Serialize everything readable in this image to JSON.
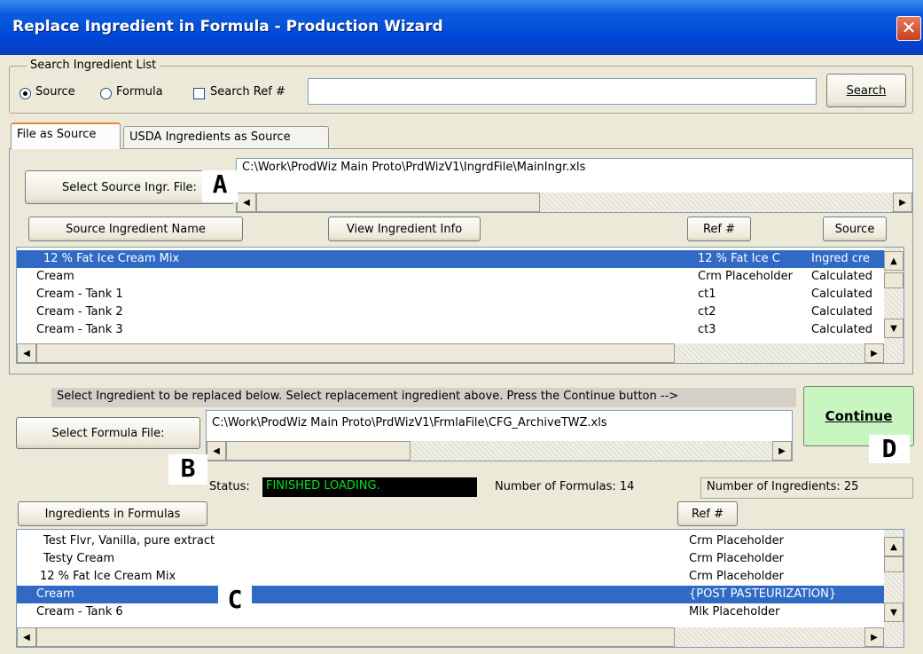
{
  "window": {
    "title": "Replace Ingredient in Formula - Production Wizard",
    "close_glyph": "✕"
  },
  "search": {
    "group_label": "Search Ingredient List",
    "radio_source_label": "Source",
    "radio_formula_label": "Formula",
    "radio_selected": "Source",
    "checkbox_label": "Search Ref #",
    "checkbox_checked": false,
    "input_value": "",
    "button_label": "Search"
  },
  "tabs": [
    {
      "label": "File as Source",
      "active": true
    },
    {
      "label": "USDA Ingredients as Source",
      "active": false
    }
  ],
  "source": {
    "select_button_label": "Select Source Ingr. File:",
    "file_path": "C:\\Work\\ProdWiz Main Proto\\PrdWizV1\\IngrdFile\\MainIngr.xls",
    "header_buttons": {
      "name": "Source Ingredient Name",
      "info": "View Ingredient Info",
      "ref": "Ref #",
      "source": "Source"
    },
    "rows": [
      {
        "name": "12 % Fat Ice Cream Mix",
        "ref": "12 % Fat Ice C",
        "source": "Ingred cre",
        "selected": true
      },
      {
        "name": "Cream",
        "ref": "Crm Placeholder",
        "source": "Calculated",
        "selected": false
      },
      {
        "name": "Cream - Tank 1",
        "ref": "ct1",
        "source": "Calculated",
        "selected": false
      },
      {
        "name": "Cream - Tank 2",
        "ref": "ct2",
        "source": "Calculated",
        "selected": false
      },
      {
        "name": "Cream - Tank 3",
        "ref": "ct3",
        "source": "Calculated",
        "selected": false
      }
    ]
  },
  "formula": {
    "instruction": "Select Ingredient to be replaced below. Select replacement ingredient above. Press the Continue button -->",
    "continue_label": "Continue",
    "select_button_label": "Select Formula File:",
    "file_path": "C:\\Work\\ProdWiz Main Proto\\PrdWizV1\\FrmlaFile\\CFG_ArchiveTWZ.xls",
    "status_label": "Status:",
    "status_value": "FINISHED LOADING.",
    "formulas_count_label": "Number of Formulas: 14",
    "ingredients_count_label": "Number of Ingredients: 25",
    "header_buttons": {
      "name": "Ingredients in Formulas",
      "ref": "Ref #"
    },
    "rows": [
      {
        "name": "Test Flvr, Vanilla, pure extract",
        "ref": "Crm Placeholder",
        "selected": false
      },
      {
        "name": "Testy Cream",
        "ref": "Crm Placeholder",
        "selected": false
      },
      {
        "name": "12 % Fat Ice Cream Mix",
        "ref": "Crm Placeholder",
        "selected": false
      },
      {
        "name": "Cream",
        "ref": "{POST PASTEURIZATION}",
        "selected": true
      },
      {
        "name": "Cream - Tank 6",
        "ref": "Mlk Placeholder",
        "selected": false
      }
    ]
  },
  "markers": {
    "a": "A",
    "b": "B",
    "c": "C",
    "d": "D"
  },
  "scroll_glyphs": {
    "up": "▲",
    "down": "▼",
    "left": "◀",
    "right": "▶"
  },
  "colors": {
    "title_bar": "#0046d5",
    "selection": "#316ac5",
    "status_bg": "#000000",
    "status_text": "#00e020",
    "continue_bg": "#c8f5c0"
  }
}
